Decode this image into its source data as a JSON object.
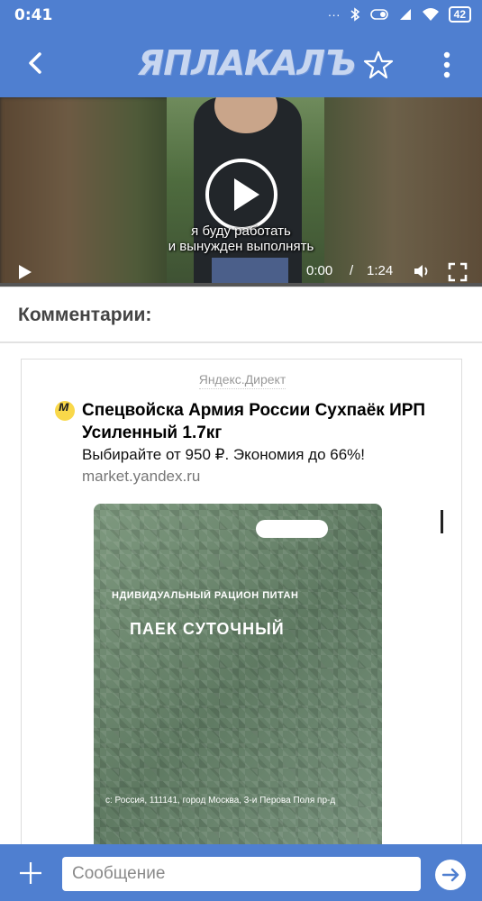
{
  "status_bar": {
    "time": "0:41",
    "battery": "42",
    "icons": [
      "dots-icon",
      "bluetooth-icon",
      "vibrate-icon",
      "signal-icon",
      "wifi-icon",
      "battery-icon"
    ]
  },
  "app_bar": {
    "logo": "ЯПЛАКАЛЪ"
  },
  "video": {
    "subtitle_line1": "я буду работать",
    "subtitle_line2": "и вынужден выполнять",
    "current_time": "0:00",
    "separator": "/",
    "duration": "1:24",
    "progress": 0
  },
  "comments": {
    "title": "Комментарии:"
  },
  "ad": {
    "source": "Яндекс.Директ",
    "title": "Спецвойска Армия России Сухпаёк ИРП Усиленный 1.7кг",
    "description": "Выбирайте от 950 ₽. Экономия до 66%!",
    "domain": "market.yandex.ru",
    "photo": {
      "line1": "НДИВИДУАЛЬНЫЙ РАЦИОН ПИТАН",
      "line2": "ПАЕК СУТОЧНЫЙ",
      "line3": "с: Россия, 111141, город Москва, 3-и Перова Поля пр-д"
    }
  },
  "composer": {
    "placeholder": "Сообщение"
  },
  "colors": {
    "accent": "#4f7fd0",
    "background": "#ffffff"
  }
}
